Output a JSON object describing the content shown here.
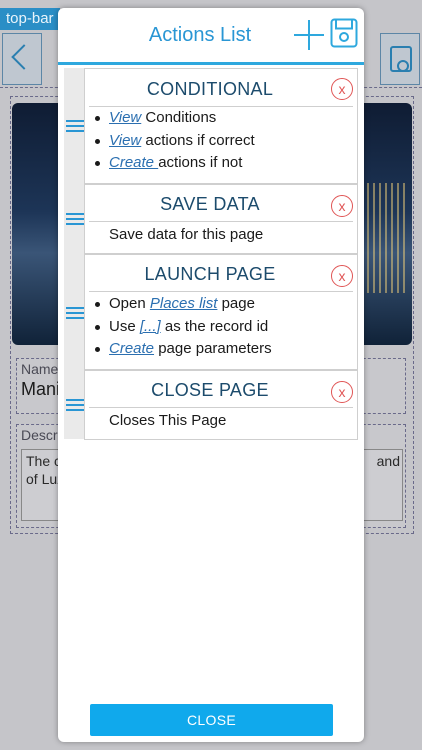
{
  "background": {
    "topbar_tag": "top-bar",
    "name_label": "Name",
    "name_value": "Mani",
    "desc_label": "Descr",
    "desc_text_line1": "The c",
    "desc_text_line1_end": "and",
    "desc_text_line2": "of Luz"
  },
  "modal": {
    "title": "Actions List",
    "close_label": "CLOSE"
  },
  "actions": {
    "conditional": {
      "title": "CONDITIONAL",
      "remove": "x",
      "row1_link": "View",
      "row1_text": " Conditions",
      "row2_link": "View",
      "row2_text": " actions if correct",
      "row3_link": "Create ",
      "row3_text": "actions if not"
    },
    "save_data": {
      "title": "SAVE DATA",
      "remove": "x",
      "text": "Save data for this page"
    },
    "launch_page": {
      "title": "LAUNCH PAGE",
      "remove": "x",
      "row1_pre": "Open ",
      "row1_link": "Places list",
      "row1_post": " page",
      "row2_pre": "Use ",
      "row2_link": "[...]",
      "row2_post": " as the record id",
      "row3_link": "Create",
      "row3_post": " page parameters"
    },
    "close_page": {
      "title": "CLOSE PAGE",
      "remove": "x",
      "text": "Closes This Page"
    }
  },
  "colors": {
    "accent": "#2996d4",
    "close_button": "#10a9ec",
    "remove": "#e05555",
    "card_title": "#1c4b6c"
  }
}
